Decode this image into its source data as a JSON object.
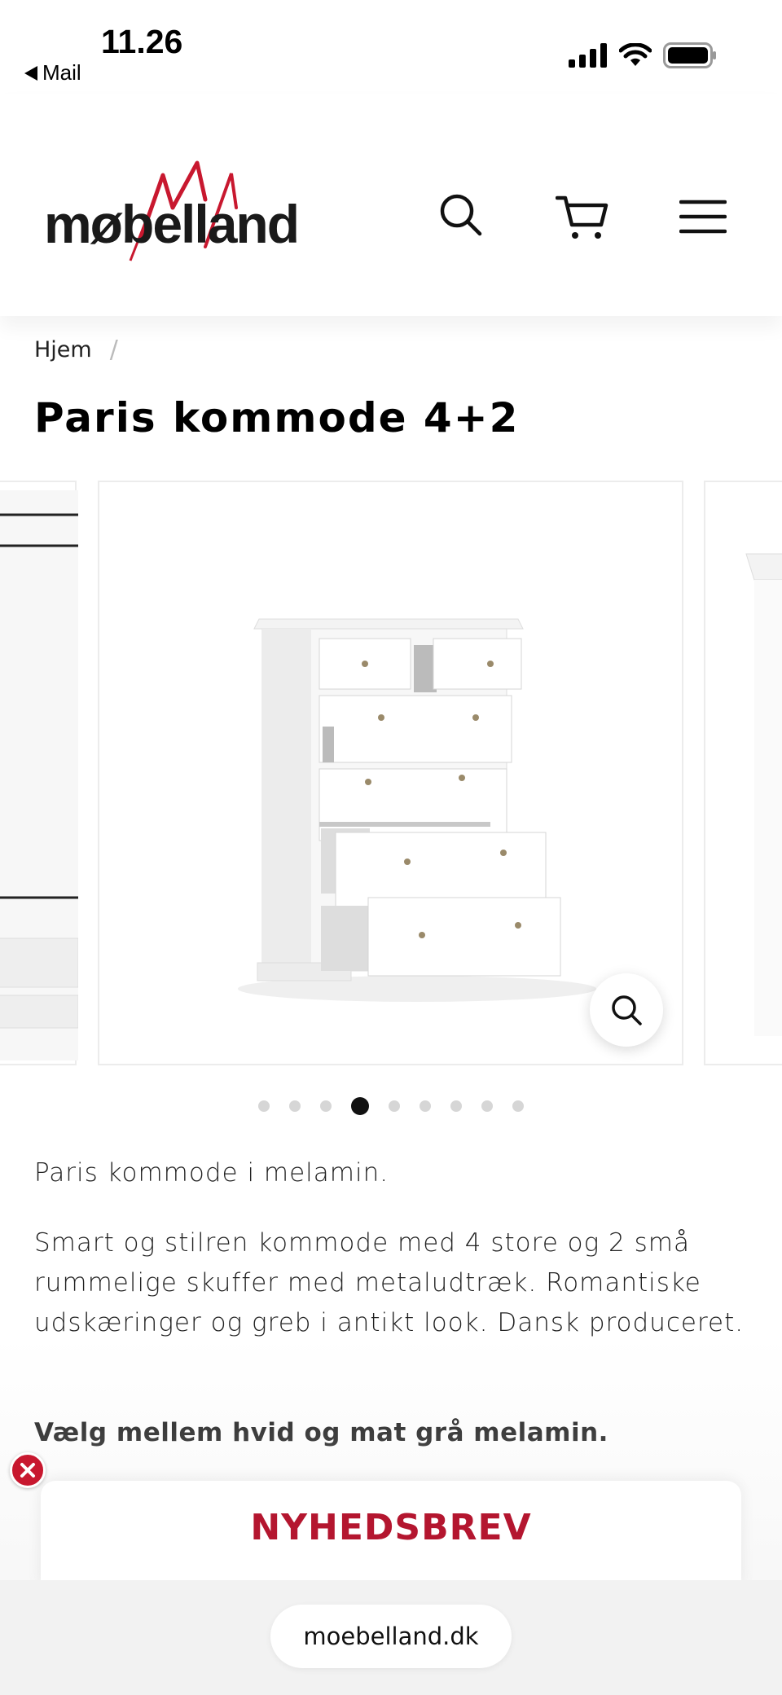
{
  "status_bar": {
    "time": "11.26",
    "back_app": "Mail"
  },
  "header": {
    "logo_text": "møbelland",
    "icons": [
      "search-icon",
      "cart-icon",
      "menu-icon"
    ]
  },
  "breadcrumb": {
    "home": "Hjem",
    "separator": "/"
  },
  "product": {
    "title": "Paris kommode 4+2",
    "gallery_total": 9,
    "gallery_active_index": 3,
    "description_1": "Paris kommode i melamin.",
    "description_2": "Smart og stilren kommode med 4 store og 2 små rummelige skuffer med metaludtræk. Romantiske udskæringer og greb i antikt look. Dansk produceret.",
    "description_3": "Vælg mellem hvid og mat grå melamin."
  },
  "newsletter": {
    "title": "NYHEDSBREV"
  },
  "browser": {
    "url": "moebelland.dk"
  },
  "colors": {
    "brand_red": "#b4162f",
    "close_red": "#c8182f",
    "text": "#111111"
  }
}
